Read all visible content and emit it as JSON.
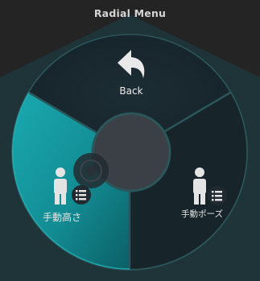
{
  "window": {
    "title": "Radial Menu"
  },
  "radial_menu": {
    "items": [
      {
        "id": "back",
        "label": "Back",
        "icon": "back-arrow-icon",
        "selected": false
      },
      {
        "id": "manual-height",
        "label": "手動高さ",
        "icon": "person-list-icon",
        "selected": true
      },
      {
        "id": "manual-pose",
        "label": "手動ポーズ",
        "icon": "person-list-icon",
        "selected": false
      }
    ]
  },
  "colors": {
    "background": "#242424",
    "hexagon": "#1e3438",
    "ring": "#2c5a5e",
    "segment": "#1a2a30",
    "selected_segment": "#169ba2",
    "center": "#3b3f46",
    "text": "#e6e6e6"
  }
}
